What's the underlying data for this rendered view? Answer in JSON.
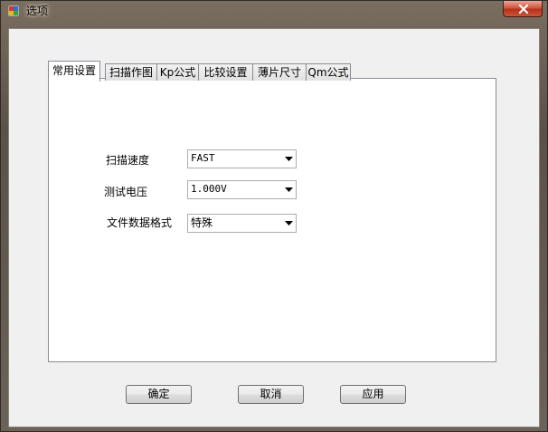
{
  "window": {
    "title": "选项"
  },
  "tabs": [
    {
      "label": "常用设置",
      "active": true
    },
    {
      "label": "扫描作图",
      "active": false
    },
    {
      "label": "Kp公式",
      "active": false
    },
    {
      "label": "比较设置",
      "active": false
    },
    {
      "label": "薄片尺寸",
      "active": false
    },
    {
      "label": "Qm公式",
      "active": false
    }
  ],
  "settings": {
    "scan_speed": {
      "label": "扫描速度",
      "value": "FAST"
    },
    "test_voltage": {
      "label": "测试电压",
      "value": "1.000V"
    },
    "file_format": {
      "label": "文件数据格式",
      "value": "特殊"
    }
  },
  "buttons": {
    "ok": "确定",
    "cancel": "取消",
    "apply": "应用"
  },
  "icons": {
    "app": "app-window-icon",
    "close": "close-icon",
    "dropdown": "chevron-down-icon"
  },
  "colors": {
    "close_button": "#c8553a",
    "panel_bg": "#ffffff",
    "dialog_bg": "#f0f0f0"
  }
}
